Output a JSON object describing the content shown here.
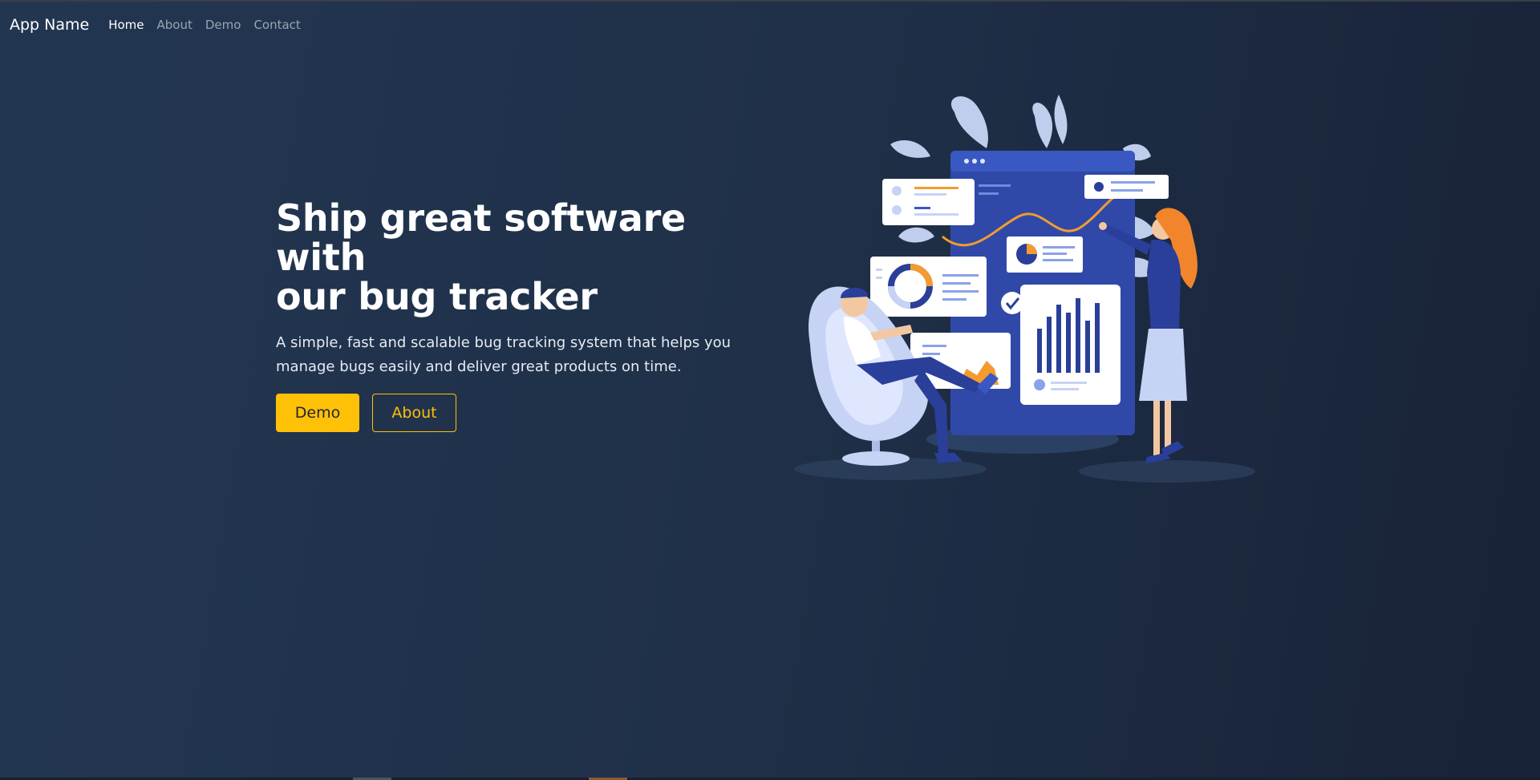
{
  "navbar": {
    "brand": "App Name",
    "links": [
      {
        "label": "Home",
        "active": true
      },
      {
        "label": "About",
        "active": false
      },
      {
        "label": "Demo",
        "active": false
      },
      {
        "label": "Contact",
        "active": false
      }
    ]
  },
  "hero": {
    "title_line1": "Ship great software with",
    "title_line2": "our bug tracker",
    "subtitle": "A simple, fast and scalable bug tracking system that helps you manage bugs easily and deliver great products on time.",
    "primary_button": "Demo",
    "secondary_button": "About"
  },
  "colors": {
    "background": "#1f3048",
    "accent": "#ffc107",
    "text": "#ffffff"
  },
  "illustration": {
    "icon": "dashboard-team-illustration"
  }
}
